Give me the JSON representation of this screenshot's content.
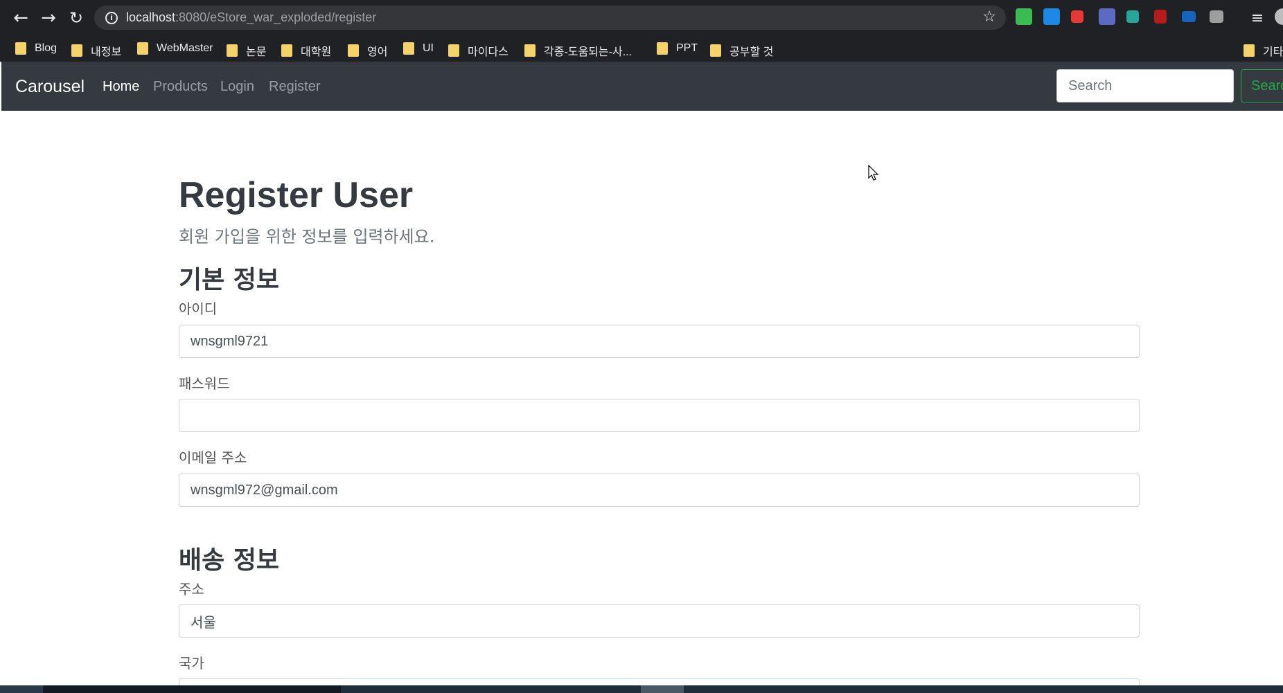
{
  "browser": {
    "url_host": "localhost",
    "url_path": ":8080/eStore_war_exploded/register",
    "bookmarks": [
      "Blog",
      "내정보",
      "WebMaster",
      "논문",
      "대학원",
      "영어",
      "UI",
      "마이다스",
      "각종-도움되는-사...",
      "PPT",
      "공부할 것",
      "기타"
    ]
  },
  "navbar": {
    "brand": "Carousel",
    "links": [
      "Home",
      "Products",
      "Login",
      "Register"
    ],
    "search_placeholder": "Search",
    "search_button": "Search"
  },
  "page": {
    "title": "Register User",
    "subtitle": "회원 가입을 위한 정보를 입력하세요.",
    "basic_section": "기본 정보",
    "shipping_section": "배송 정보",
    "fields": {
      "id_label": "아이디",
      "id_value": "wnsgml9721",
      "password_label": "패스워드",
      "password_value": "",
      "email_label": "이메일 주소",
      "email_value": "wnsgml972@gmail.com",
      "address_label": "주소",
      "address_value": "서울",
      "country_label": "국가"
    }
  },
  "colors": {
    "chrome_bg": "#202124",
    "navbar_bg": "#343a40",
    "search_button": "#28a745"
  }
}
